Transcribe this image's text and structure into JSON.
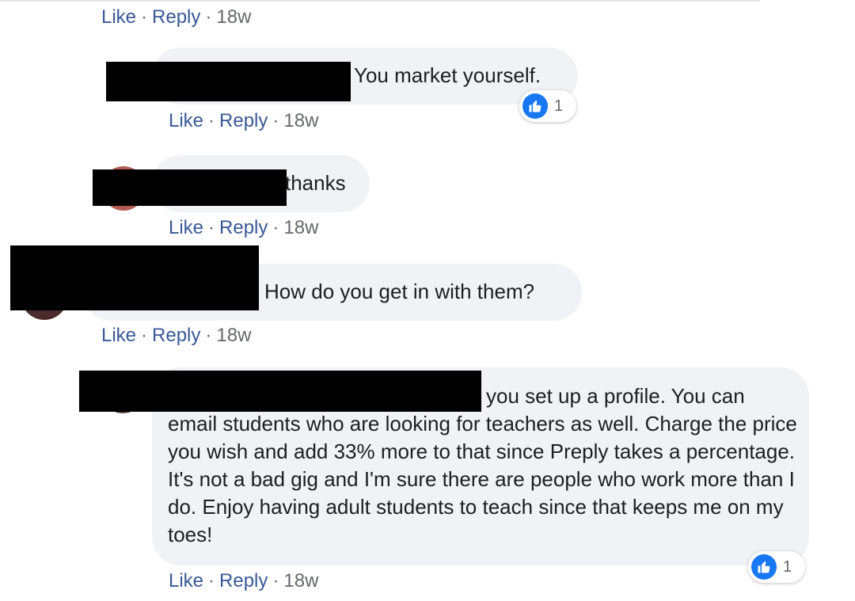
{
  "actions": {
    "like": "Like",
    "reply": "Reply",
    "separator": "·"
  },
  "comments": [
    {
      "time": "18w"
    },
    {
      "text": "You market yourself.",
      "time": "18w",
      "reactions": "1"
    },
    {
      "text": "thanks",
      "time": "18w"
    },
    {
      "text": "How do you get in with them?",
      "time": "18w"
    },
    {
      "text": "you set up a profile. You can email students who are looking for teachers as well. Charge the price you wish and add 33% more to that since Preply takes a percentage. It's not a bad gig and I'm sure there are people who work more than I do. Enjoy having adult students to teach since that keeps me on my toes!",
      "time": "18w",
      "reactions": "1"
    }
  ],
  "colors": {
    "bubble": "#f0f2f5",
    "link": "#385898",
    "like_blue": "#1877f2",
    "muted": "#65676b"
  }
}
